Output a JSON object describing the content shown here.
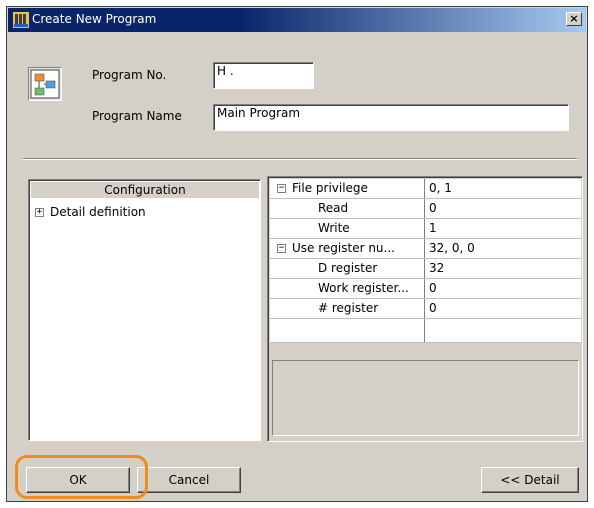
{
  "window": {
    "title": "Create New Program",
    "close_label": "×"
  },
  "form": {
    "program_no_label": "Program No.",
    "program_no_value": "H .",
    "program_name_label": "Program Name",
    "program_name_value": "Main Program"
  },
  "tree": {
    "header": "Configuration",
    "items": [
      {
        "expander": "+",
        "label": "Detail definition"
      }
    ]
  },
  "properties": {
    "rows": [
      {
        "expander": "−",
        "name": "File privilege",
        "value": "0, 1"
      },
      {
        "name": "Read",
        "value": "0"
      },
      {
        "name": "Write",
        "value": "1"
      },
      {
        "expander": "−",
        "name": "Use register nu...",
        "value": "32, 0, 0"
      },
      {
        "name": "D register",
        "value": "32"
      },
      {
        "name": "Work register...",
        "value": "0"
      },
      {
        "name": "# register",
        "value": "0"
      },
      {
        "name": "",
        "value": ""
      }
    ]
  },
  "buttons": {
    "ok": "OK",
    "cancel": "Cancel",
    "detail": "<< Detail"
  },
  "colors": {
    "highlight": "#f08c1e",
    "titlebar": "#0a246a"
  }
}
